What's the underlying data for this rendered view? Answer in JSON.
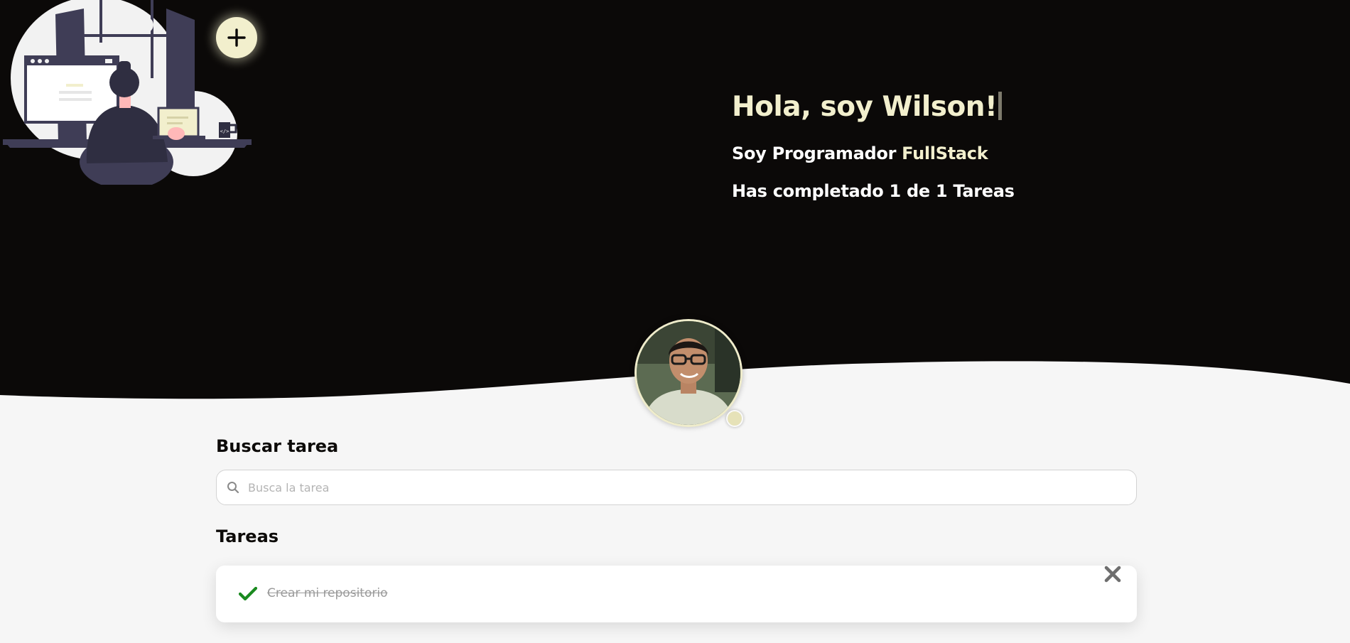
{
  "colors": {
    "dark": "#0b0908",
    "cream": "#f2efcd",
    "page_bg": "#f6f6f6",
    "check": "#1a8a1f",
    "muted": "#9a9a9a"
  },
  "icons": {
    "add": "plus-icon",
    "search": "search-icon",
    "complete": "check-icon",
    "delete": "close-icon"
  },
  "hero": {
    "greeting": "Hola, soy Wilson!",
    "role_prefix": "Soy Programador",
    "role_highlight": "FullStack",
    "progress": "Has completado 1 de 1 Tareas"
  },
  "search": {
    "title": "Buscar tarea",
    "placeholder": "Busca la tarea"
  },
  "tasks": {
    "title": "Tareas",
    "items": [
      {
        "text": "Crear mi repositorio",
        "completed": true
      }
    ]
  }
}
